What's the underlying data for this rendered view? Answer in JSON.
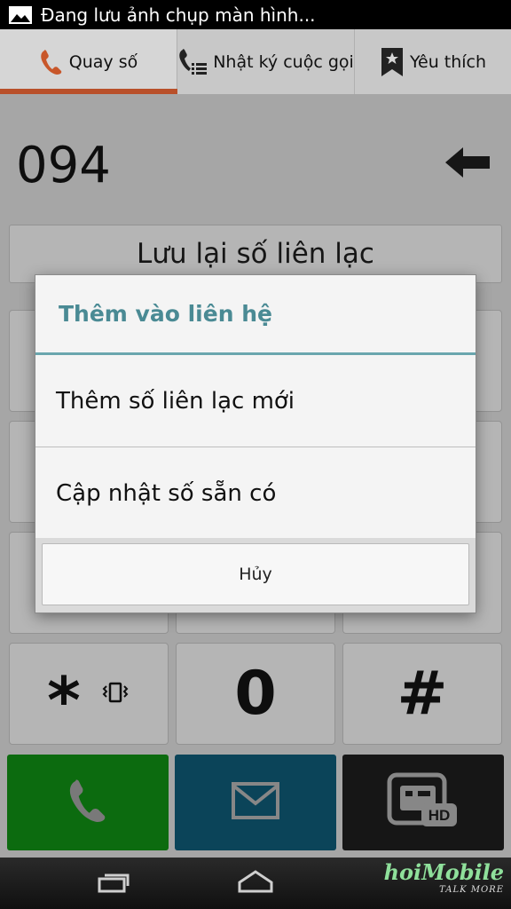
{
  "status_bar": {
    "notification_text": "Đang lưu ảnh chụp màn hình..."
  },
  "tabs": [
    {
      "label": "Quay số",
      "active": true
    },
    {
      "label": "Nhật ký cuộc gọi",
      "active": false
    },
    {
      "label": "Yêu thích",
      "active": false
    }
  ],
  "dialer": {
    "number": "094",
    "save_contact_label": "Lưu lại số liên lạc"
  },
  "keypad": {
    "star": "*",
    "zero": "0",
    "hash": "#"
  },
  "dialog": {
    "title": "Thêm vào liên hệ",
    "items": [
      {
        "label": "Thêm số liên lạc mới"
      },
      {
        "label": "Cập nhật số sẵn có"
      }
    ],
    "cancel_label": "Hủy"
  },
  "watermark": {
    "text": "hoiMobile",
    "tagline": "TALK MORE"
  },
  "colors": {
    "accent_tab": "#b9502a",
    "dialog_title": "#4a8a94",
    "call_button": "#0e7a12",
    "sms_button": "#0d4e66",
    "video_button": "#1a1a1a"
  }
}
